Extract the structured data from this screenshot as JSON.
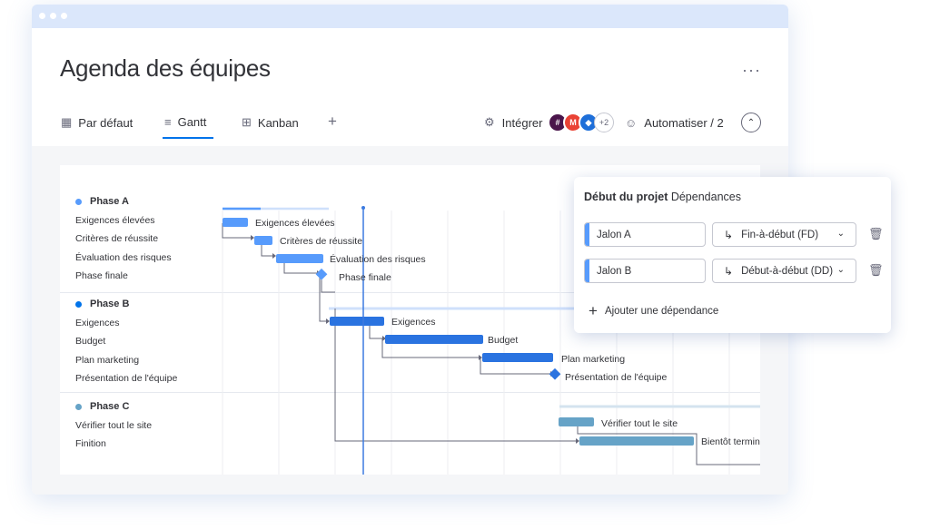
{
  "board": {
    "title": "Agenda des équipes",
    "more_label": "···"
  },
  "views": {
    "tabs": [
      {
        "label": "Par défaut",
        "icon": "table-icon",
        "glyph": "▦"
      },
      {
        "label": "Gantt",
        "icon": "gantt-icon",
        "glyph": "≡"
      },
      {
        "label": "Kanban",
        "icon": "kanban-icon",
        "glyph": "⊞"
      }
    ],
    "add_label": "+",
    "integrate_label": "Intégrer",
    "integration_more": "+2",
    "automate_label": "Automatiser / 2",
    "collapse_glyph": "⌃"
  },
  "gantt": {
    "phases": [
      {
        "name": "Phase A",
        "color": "#579bfc",
        "tasks": [
          "Exigences élevées",
          "Critères de réussite",
          "Évaluation des risques",
          "Phase finale"
        ]
      },
      {
        "name": "Phase B",
        "color": "#0073ea",
        "tasks": [
          "Exigences",
          "Budget",
          "Plan marketing",
          "Présentation de l'équipe"
        ]
      },
      {
        "name": "Phase C",
        "color": "#66a3c7",
        "tasks": [
          "Vérifier tout le site",
          "Finition"
        ]
      }
    ],
    "bar_labels": [
      "Exigences élevées",
      "Critères de réussite",
      "Évaluation des risques",
      "Phase finale",
      "Exigences",
      "Budget",
      "Plan marketing",
      "Présentation de l'équipe",
      "Vérifier tout le site",
      "Bientôt termin"
    ]
  },
  "popup": {
    "title_bold": "Début du projet",
    "title_rest": " Dépendances",
    "dependencies": [
      {
        "name": "Jalon A",
        "type": "Fin-à-début (FD)"
      },
      {
        "name": "Jalon B",
        "type": "Début-à-début (DD)"
      }
    ],
    "add_label": "Ajouter une dépendance"
  },
  "colors": {
    "phase_a": "#579bfc",
    "phase_b": "#2a73e0",
    "phase_c": "#66a3c7",
    "today_line": "#3d7be0"
  }
}
